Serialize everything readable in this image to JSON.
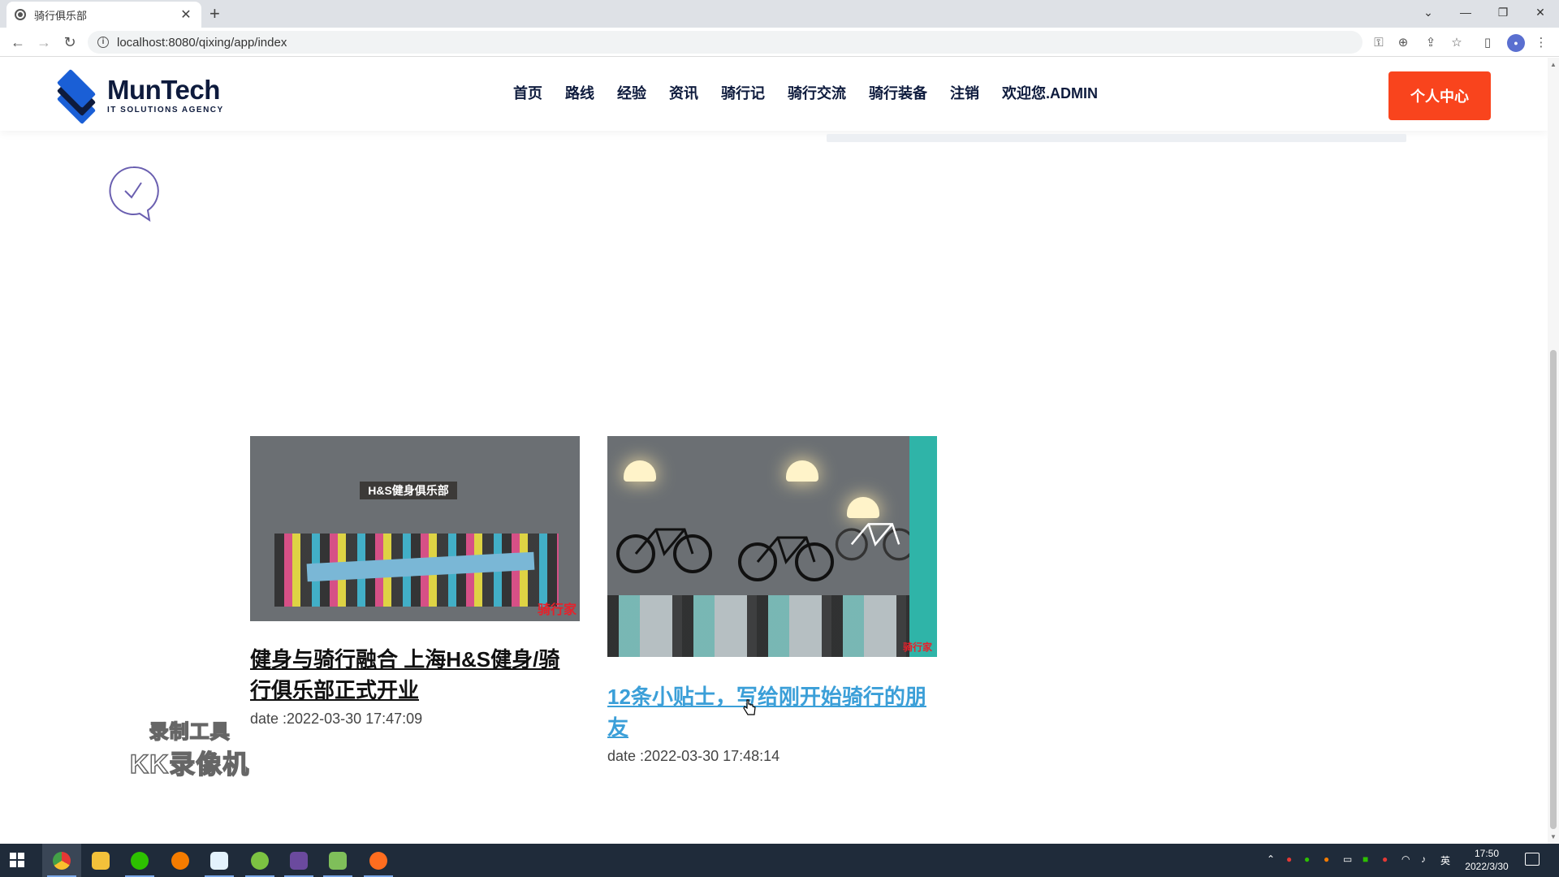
{
  "browser": {
    "tab_title": "骑行俱乐部",
    "tab_close": "✕",
    "new_tab": "+",
    "url": "localhost:8080/qixing/app/index"
  },
  "site": {
    "logo_name": "MunTech",
    "logo_tagline": "IT SOLUTIONS AGENCY",
    "nav": [
      {
        "label": "首页"
      },
      {
        "label": "路线"
      },
      {
        "label": "经验"
      },
      {
        "label": "资讯"
      },
      {
        "label": "骑行记"
      },
      {
        "label": "骑行交流"
      },
      {
        "label": "骑行装备"
      },
      {
        "label": "注销"
      },
      {
        "label": "欢迎您.ADMIN"
      }
    ],
    "cta_label": "个人中心"
  },
  "articles": [
    {
      "title": "健身与骑行融合 上海H&S健身/骑行俱乐部正式开业",
      "date": "date :2022-03-30 17:47:09",
      "image_sign": "H&S健身俱乐部",
      "image_watermark": "骑行家"
    },
    {
      "title": "12条小贴士，写给刚开始骑行的朋友",
      "date": "date :2022-03-30 17:48:14",
      "image_watermark": "骑行家"
    }
  ],
  "overlay": {
    "line1": "录制工具",
    "line2": "KK录像机"
  },
  "taskbar": {
    "ime": "英",
    "time": "17:50",
    "date": "2022/3/30"
  },
  "colors": {
    "accent": "#f9441d",
    "brand_dark": "#0e1b3d",
    "brand_blue": "#1a5fd6",
    "link_hover": "#3b9fd8"
  }
}
